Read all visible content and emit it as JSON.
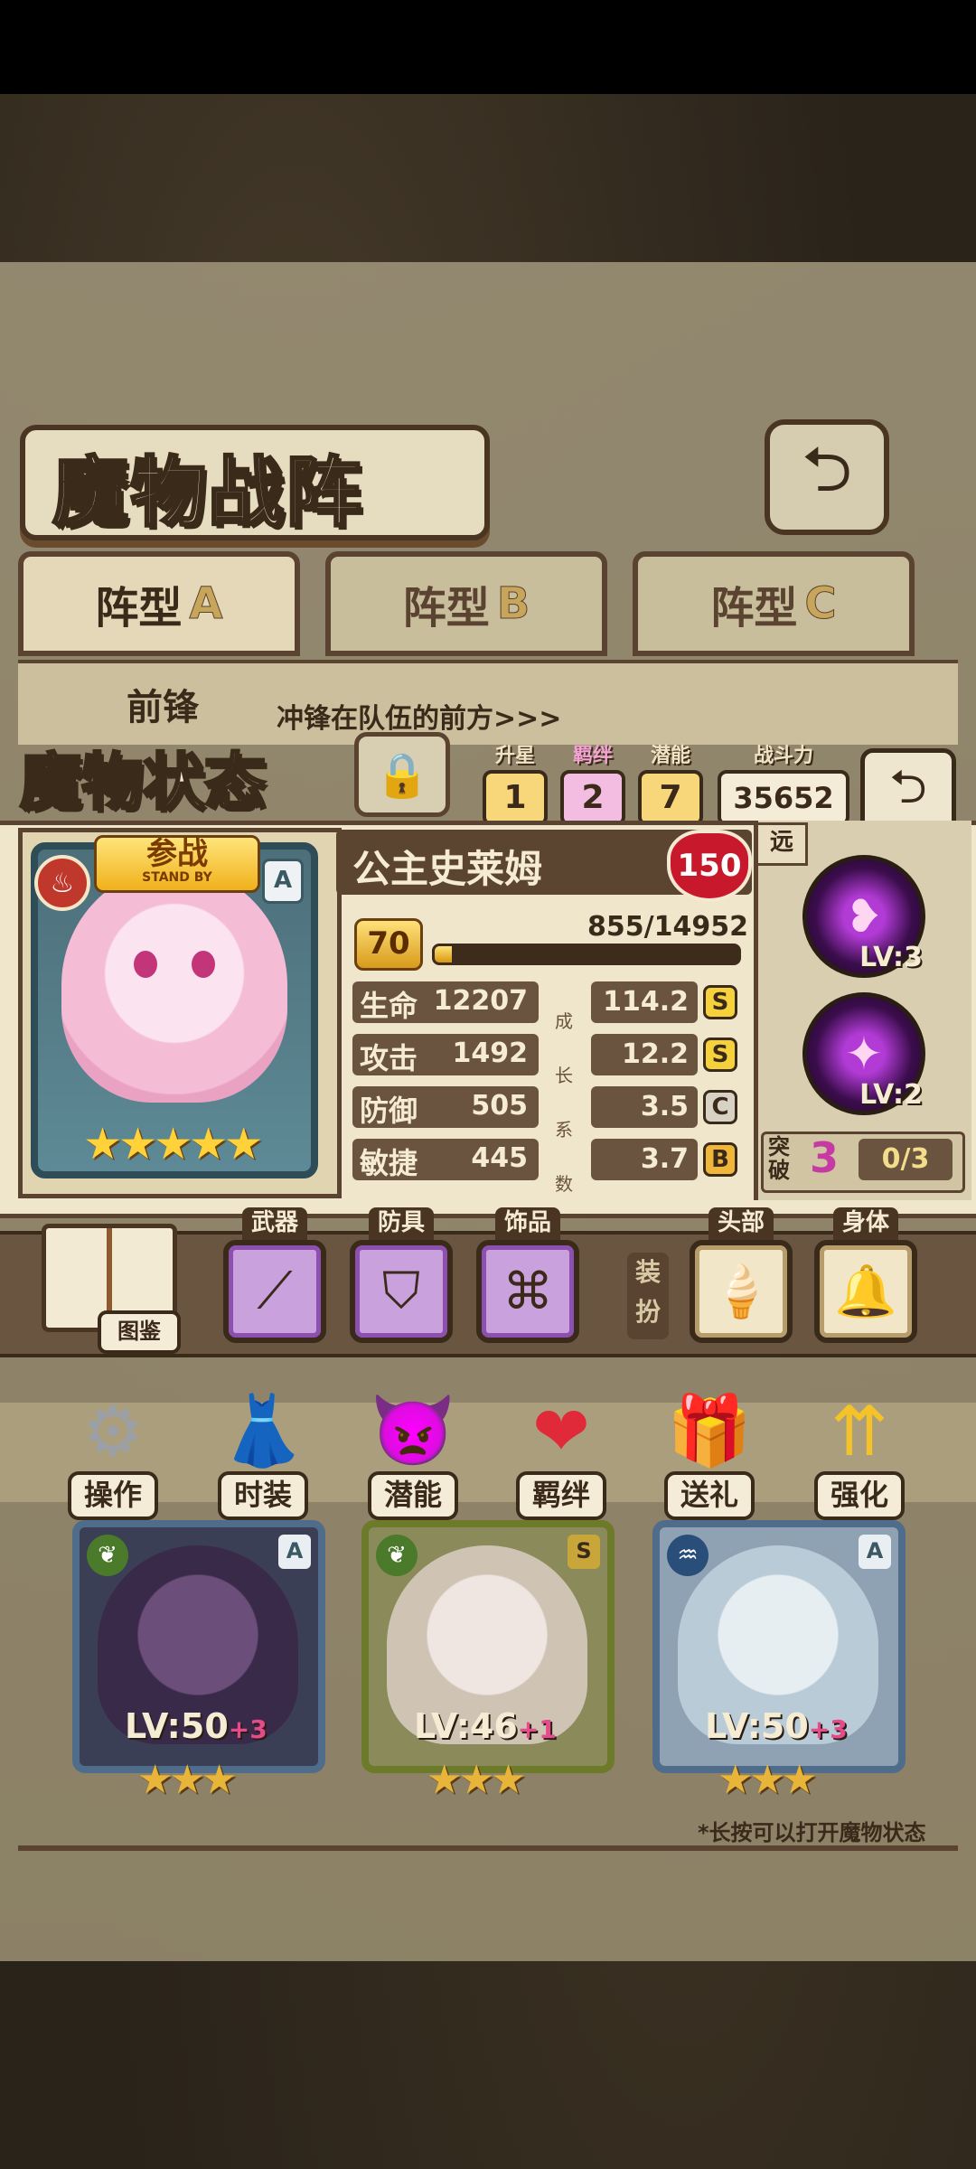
{
  "header": {
    "title": "魔物战阵",
    "back_icon": "return-arrow-icon"
  },
  "formation_tabs": [
    {
      "label": "阵型",
      "letter": "A",
      "active": true
    },
    {
      "label": "阵型",
      "letter": "B",
      "active": false
    },
    {
      "label": "阵型",
      "letter": "C",
      "active": false
    }
  ],
  "front_row": {
    "label": "前锋",
    "description": "冲锋在队伍的前方>>>"
  },
  "status": {
    "title": "魔物状态",
    "lock_icon": "padlock-icon",
    "star_up": {
      "label": "升星",
      "value": "1"
    },
    "bond": {
      "label": "羁绊",
      "value": "2"
    },
    "potential": {
      "label": "潜能",
      "value": "7"
    },
    "power": {
      "label": "战斗力",
      "value": "35652"
    }
  },
  "monster": {
    "name": "公主史莱姆",
    "standby_cn": "参战",
    "standby_en": "STAND BY",
    "element_icon": "fire-icon",
    "rank": "A",
    "stars": 5,
    "level_cap": "150",
    "level": "70",
    "exp_text": "855/14952",
    "exp_fraction": 0.057,
    "range_tag": "远",
    "stats": [
      {
        "name": "生命",
        "value": "12207",
        "growth": "114.2",
        "grade": "S",
        "grade_color": "#f5d23c"
      },
      {
        "name": "攻击",
        "value": "1492",
        "growth": "12.2",
        "grade": "S",
        "grade_color": "#f5d23c"
      },
      {
        "name": "防御",
        "value": "505",
        "growth": "3.5",
        "grade": "C",
        "grade_color": "#d8d2c4"
      },
      {
        "name": "敏捷",
        "value": "445",
        "growth": "3.7",
        "grade": "B",
        "grade_color": "#f0b63a"
      }
    ],
    "growth_label": [
      "成",
      "长",
      "系",
      "数"
    ],
    "skills": [
      {
        "icon": "heart-dash-skill-icon",
        "level": "LV:3"
      },
      {
        "icon": "sparkle-skill-icon",
        "level": "LV:2"
      }
    ],
    "breakthrough": {
      "label": "突破",
      "value": "3",
      "progress": "0/3"
    }
  },
  "equipment": {
    "book_label": "图鉴",
    "slots": [
      {
        "label": "武器",
        "icon": "spear-icon"
      },
      {
        "label": "防具",
        "icon": "gauntlet-icon"
      },
      {
        "label": "饰品",
        "icon": "pendant-icon"
      }
    ],
    "dress_label": "装扮",
    "dress_slots": [
      {
        "label": "头部",
        "icon": "ice-cream-cone-hat-icon"
      },
      {
        "label": "身体",
        "icon": "bell-collar-icon"
      }
    ]
  },
  "actions": [
    {
      "label": "操作",
      "icon": "gears-icon"
    },
    {
      "label": "时装",
      "icon": "outfit-icon"
    },
    {
      "label": "潜能",
      "icon": "shadow-demon-icon"
    },
    {
      "label": "羁绊",
      "icon": "hearts-icon"
    },
    {
      "label": "送礼",
      "icon": "gift-box-icon"
    },
    {
      "label": "强化",
      "icon": "upgrade-arrows-icon"
    }
  ],
  "team": [
    {
      "level": "LV:50",
      "plus": "+3",
      "rank": "A",
      "element": "leaf-icon",
      "stars": 3
    },
    {
      "level": "LV:46",
      "plus": "+1",
      "rank": "S",
      "element": "leaf-icon",
      "stars": 3
    },
    {
      "level": "LV:50",
      "plus": "+3",
      "rank": "A",
      "element": "water-icon",
      "stars": 3
    }
  ],
  "hint": "*长按可以打开魔物状态"
}
